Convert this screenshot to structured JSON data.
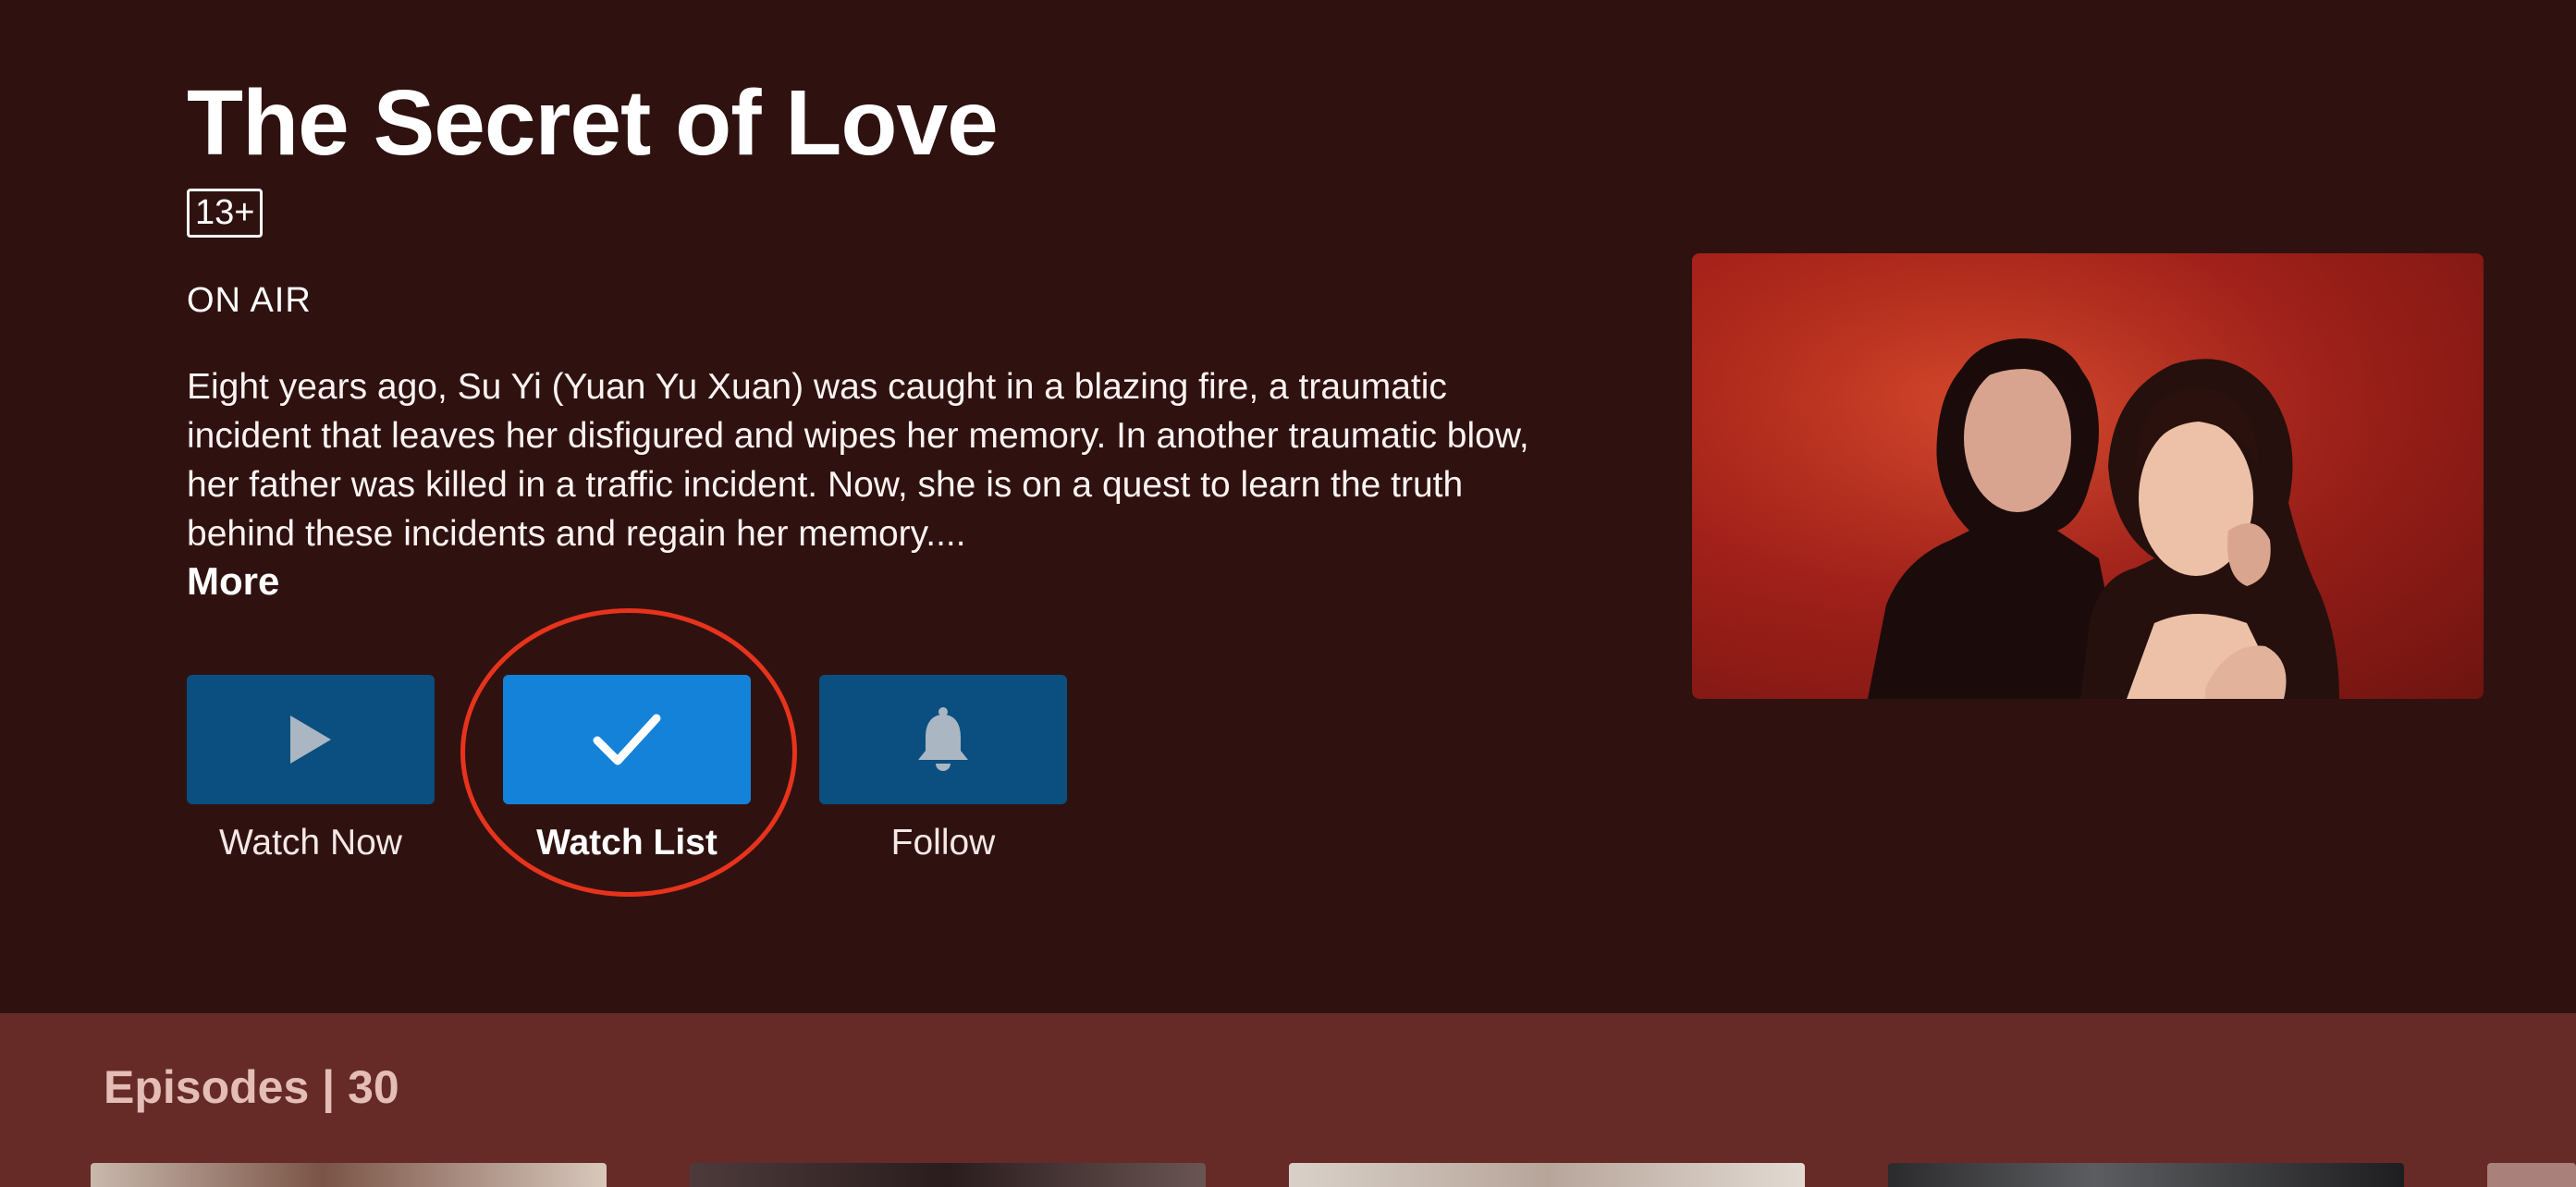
{
  "show": {
    "title": "The Secret of Love",
    "rating": "13+",
    "status": "ON AIR",
    "synopsis": "Eight years ago, Su Yi (Yuan Yu Xuan) was caught in a blazing fire, a traumatic incident that leaves her disfigured and wipes her memory. In another traumatic blow, her father was killed in a traffic incident. Now, she is on a quest to learn the truth behind these incidents and regain her memory....",
    "more_label": "More"
  },
  "actions": {
    "watch_now": {
      "label": "Watch Now",
      "icon": "play-icon"
    },
    "watch_list": {
      "label": "Watch List",
      "icon": "checkmark-icon",
      "focused": true
    },
    "follow": {
      "label": "Follow",
      "icon": "bell-icon"
    }
  },
  "episodes": {
    "title": "Episodes | 30"
  },
  "colors": {
    "background": "#2f1210",
    "episodes_band": "#662b26",
    "button": "#0a4f80",
    "button_focused": "#1482d9",
    "highlight_ring": "#e8331c"
  }
}
